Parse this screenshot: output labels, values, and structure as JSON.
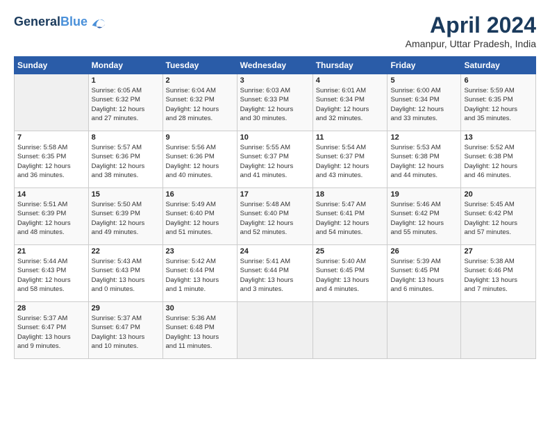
{
  "header": {
    "logo_line1": "General",
    "logo_line2": "Blue",
    "month_title": "April 2024",
    "location": "Amanpur, Uttar Pradesh, India"
  },
  "weekdays": [
    "Sunday",
    "Monday",
    "Tuesday",
    "Wednesday",
    "Thursday",
    "Friday",
    "Saturday"
  ],
  "weeks": [
    [
      {
        "day": "",
        "info": ""
      },
      {
        "day": "1",
        "info": "Sunrise: 6:05 AM\nSunset: 6:32 PM\nDaylight: 12 hours\nand 27 minutes."
      },
      {
        "day": "2",
        "info": "Sunrise: 6:04 AM\nSunset: 6:32 PM\nDaylight: 12 hours\nand 28 minutes."
      },
      {
        "day": "3",
        "info": "Sunrise: 6:03 AM\nSunset: 6:33 PM\nDaylight: 12 hours\nand 30 minutes."
      },
      {
        "day": "4",
        "info": "Sunrise: 6:01 AM\nSunset: 6:34 PM\nDaylight: 12 hours\nand 32 minutes."
      },
      {
        "day": "5",
        "info": "Sunrise: 6:00 AM\nSunset: 6:34 PM\nDaylight: 12 hours\nand 33 minutes."
      },
      {
        "day": "6",
        "info": "Sunrise: 5:59 AM\nSunset: 6:35 PM\nDaylight: 12 hours\nand 35 minutes."
      }
    ],
    [
      {
        "day": "7",
        "info": "Sunrise: 5:58 AM\nSunset: 6:35 PM\nDaylight: 12 hours\nand 36 minutes."
      },
      {
        "day": "8",
        "info": "Sunrise: 5:57 AM\nSunset: 6:36 PM\nDaylight: 12 hours\nand 38 minutes."
      },
      {
        "day": "9",
        "info": "Sunrise: 5:56 AM\nSunset: 6:36 PM\nDaylight: 12 hours\nand 40 minutes."
      },
      {
        "day": "10",
        "info": "Sunrise: 5:55 AM\nSunset: 6:37 PM\nDaylight: 12 hours\nand 41 minutes."
      },
      {
        "day": "11",
        "info": "Sunrise: 5:54 AM\nSunset: 6:37 PM\nDaylight: 12 hours\nand 43 minutes."
      },
      {
        "day": "12",
        "info": "Sunrise: 5:53 AM\nSunset: 6:38 PM\nDaylight: 12 hours\nand 44 minutes."
      },
      {
        "day": "13",
        "info": "Sunrise: 5:52 AM\nSunset: 6:38 PM\nDaylight: 12 hours\nand 46 minutes."
      }
    ],
    [
      {
        "day": "14",
        "info": "Sunrise: 5:51 AM\nSunset: 6:39 PM\nDaylight: 12 hours\nand 48 minutes."
      },
      {
        "day": "15",
        "info": "Sunrise: 5:50 AM\nSunset: 6:39 PM\nDaylight: 12 hours\nand 49 minutes."
      },
      {
        "day": "16",
        "info": "Sunrise: 5:49 AM\nSunset: 6:40 PM\nDaylight: 12 hours\nand 51 minutes."
      },
      {
        "day": "17",
        "info": "Sunrise: 5:48 AM\nSunset: 6:40 PM\nDaylight: 12 hours\nand 52 minutes."
      },
      {
        "day": "18",
        "info": "Sunrise: 5:47 AM\nSunset: 6:41 PM\nDaylight: 12 hours\nand 54 minutes."
      },
      {
        "day": "19",
        "info": "Sunrise: 5:46 AM\nSunset: 6:42 PM\nDaylight: 12 hours\nand 55 minutes."
      },
      {
        "day": "20",
        "info": "Sunrise: 5:45 AM\nSunset: 6:42 PM\nDaylight: 12 hours\nand 57 minutes."
      }
    ],
    [
      {
        "day": "21",
        "info": "Sunrise: 5:44 AM\nSunset: 6:43 PM\nDaylight: 12 hours\nand 58 minutes."
      },
      {
        "day": "22",
        "info": "Sunrise: 5:43 AM\nSunset: 6:43 PM\nDaylight: 13 hours\nand 0 minutes."
      },
      {
        "day": "23",
        "info": "Sunrise: 5:42 AM\nSunset: 6:44 PM\nDaylight: 13 hours\nand 1 minute."
      },
      {
        "day": "24",
        "info": "Sunrise: 5:41 AM\nSunset: 6:44 PM\nDaylight: 13 hours\nand 3 minutes."
      },
      {
        "day": "25",
        "info": "Sunrise: 5:40 AM\nSunset: 6:45 PM\nDaylight: 13 hours\nand 4 minutes."
      },
      {
        "day": "26",
        "info": "Sunrise: 5:39 AM\nSunset: 6:45 PM\nDaylight: 13 hours\nand 6 minutes."
      },
      {
        "day": "27",
        "info": "Sunrise: 5:38 AM\nSunset: 6:46 PM\nDaylight: 13 hours\nand 7 minutes."
      }
    ],
    [
      {
        "day": "28",
        "info": "Sunrise: 5:37 AM\nSunset: 6:47 PM\nDaylight: 13 hours\nand 9 minutes."
      },
      {
        "day": "29",
        "info": "Sunrise: 5:37 AM\nSunset: 6:47 PM\nDaylight: 13 hours\nand 10 minutes."
      },
      {
        "day": "30",
        "info": "Sunrise: 5:36 AM\nSunset: 6:48 PM\nDaylight: 13 hours\nand 11 minutes."
      },
      {
        "day": "",
        "info": ""
      },
      {
        "day": "",
        "info": ""
      },
      {
        "day": "",
        "info": ""
      },
      {
        "day": "",
        "info": ""
      }
    ]
  ]
}
